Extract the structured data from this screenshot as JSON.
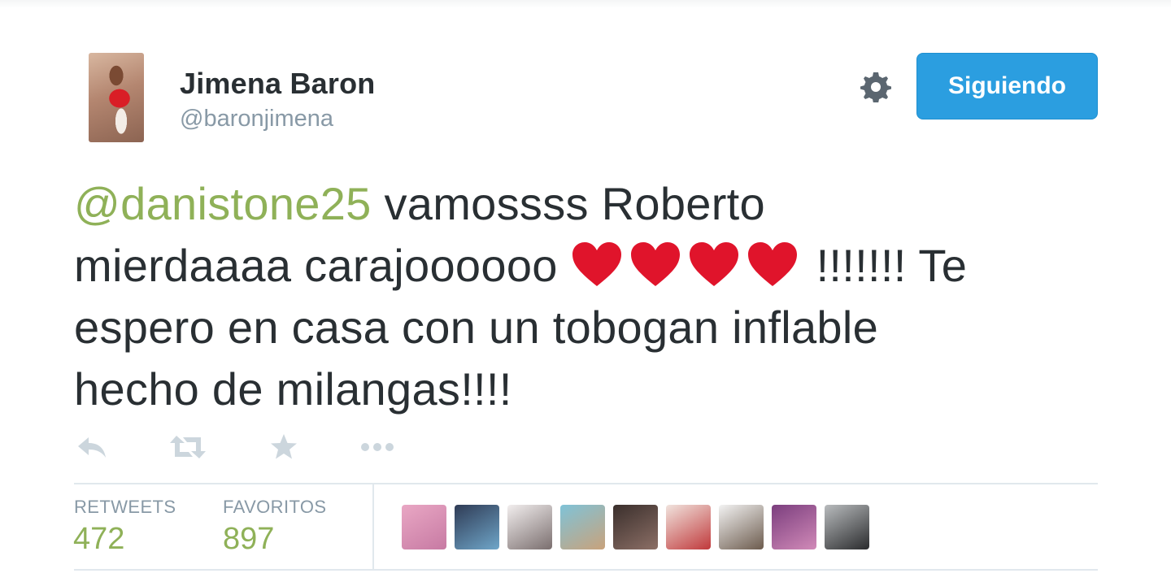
{
  "author": {
    "display_name": "Jimena Baron",
    "handle": "@baronjimena"
  },
  "header": {
    "settings_icon": "gear-icon",
    "follow_button_label": "Siguiendo",
    "follow_button_color": "#2b9ee0"
  },
  "tweet": {
    "line1_mention": "@danistone25",
    "line1_text": " vamossss Roberto",
    "line2_text_before": "mierdaaaa carajoooooo ",
    "hearts_count": 4,
    "heart_color": "#e0142b",
    "line2_text_after": "!!!!!!! Te",
    "line3_text": "espero en casa con un tobogan inflable",
    "line4_text": "hecho de milangas!!!!",
    "mention_color": "#8fb158"
  },
  "actions": [
    {
      "name": "reply-icon"
    },
    {
      "name": "retweet-icon"
    },
    {
      "name": "favorite-star-icon"
    },
    {
      "name": "more-dots-icon"
    }
  ],
  "stats": {
    "retweets_label": "RETWEETS",
    "retweets_value": "472",
    "favorites_label": "FAVORITOS",
    "favorites_value": "897"
  },
  "favoriters": [
    {
      "name": "avatar-1",
      "colors": [
        "#e9a7c4",
        "#c77aa3"
      ]
    },
    {
      "name": "avatar-2",
      "colors": [
        "#2f3b55",
        "#6fa6c9"
      ]
    },
    {
      "name": "avatar-3",
      "colors": [
        "#f2eeee",
        "#7a6e6e"
      ]
    },
    {
      "name": "avatar-4",
      "colors": [
        "#7fc3d8",
        "#c9a27b"
      ]
    },
    {
      "name": "avatar-5",
      "colors": [
        "#3a2f2c",
        "#8c6f66"
      ]
    },
    {
      "name": "avatar-6",
      "colors": [
        "#f1e4de",
        "#c0393b"
      ]
    },
    {
      "name": "avatar-7",
      "colors": [
        "#f3f3f3",
        "#6c5b4d"
      ]
    },
    {
      "name": "avatar-8",
      "colors": [
        "#7b3e7e",
        "#d18ab8"
      ]
    },
    {
      "name": "avatar-9",
      "colors": [
        "#b9bcbe",
        "#2a2b2d"
      ]
    }
  ]
}
